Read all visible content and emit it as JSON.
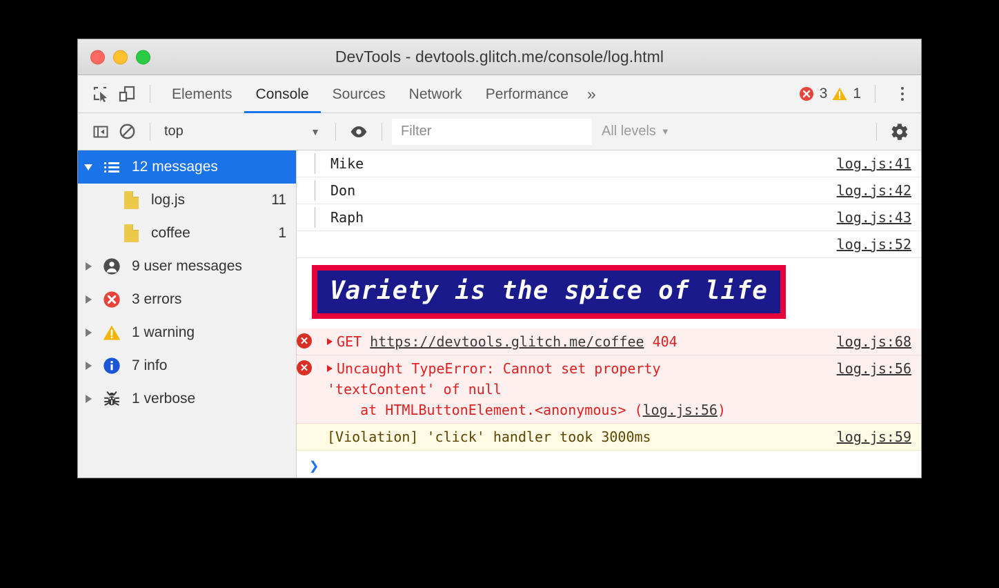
{
  "window": {
    "title": "DevTools - devtools.glitch.me/console/log.html",
    "traffic_lights": [
      "close",
      "minimize",
      "zoom"
    ]
  },
  "tabbar": {
    "inspect_icon": "inspect-element-icon",
    "device_icon": "device-toolbar-icon",
    "tabs": [
      {
        "label": "Elements",
        "active": false
      },
      {
        "label": "Console",
        "active": true
      },
      {
        "label": "Sources",
        "active": false
      },
      {
        "label": "Network",
        "active": false
      },
      {
        "label": "Performance",
        "active": false
      }
    ],
    "more_tabs_label": "»",
    "error_count": "3",
    "warning_count": "1",
    "error_icon": "error-circle-icon",
    "warning_icon": "warning-triangle-icon",
    "menu_icon": "kebab-menu-icon"
  },
  "toolbar": {
    "sidebar_toggle_icon": "sidebar-toggle-icon",
    "clear_console_icon": "clear-console-icon",
    "context": "top",
    "context_caret": "▼",
    "eye_icon": "live-expression-eye-icon",
    "filter_placeholder": "Filter",
    "filter_value": "",
    "levels_label": "All levels",
    "levels_caret": "▼",
    "settings_icon": "settings-gear-icon"
  },
  "sidebar": {
    "items": [
      {
        "label": "12 messages",
        "count": "",
        "icon": "message-list-icon",
        "selected": true,
        "expanded": true,
        "indent": 0
      },
      {
        "label": "log.js",
        "count": "11",
        "icon": "file-icon",
        "selected": false,
        "expanded": null,
        "indent": 1
      },
      {
        "label": "coffee",
        "count": "1",
        "icon": "file-icon",
        "selected": false,
        "expanded": null,
        "indent": 1
      },
      {
        "label": "9 user messages",
        "count": "",
        "icon": "user-icon",
        "selected": false,
        "expanded": false,
        "indent": 0
      },
      {
        "label": "3 errors",
        "count": "",
        "icon": "error-circle-icon",
        "selected": false,
        "expanded": false,
        "indent": 0
      },
      {
        "label": "1 warning",
        "count": "",
        "icon": "warning-triangle-icon",
        "selected": false,
        "expanded": false,
        "indent": 0
      },
      {
        "label": "7 info",
        "count": "",
        "icon": "info-circle-icon",
        "selected": false,
        "expanded": false,
        "indent": 0
      },
      {
        "label": "1 verbose",
        "count": "",
        "icon": "bug-icon",
        "selected": false,
        "expanded": false,
        "indent": 0
      }
    ]
  },
  "console": {
    "messages": [
      {
        "type": "log",
        "text": "Mike",
        "source": "log.js:41",
        "grouped": true
      },
      {
        "type": "log",
        "text": "Don",
        "source": "log.js:42",
        "grouped": true
      },
      {
        "type": "log",
        "text": "Raph",
        "source": "log.js:43",
        "grouped": true
      },
      {
        "type": "styled",
        "text": "Variety is the spice of life",
        "source": "log.js:52",
        "grouped": false,
        "style": {
          "background": "#1a1a8c",
          "border_color": "#e6003c",
          "color": "#ffffff"
        }
      },
      {
        "type": "error-network",
        "method": "GET",
        "url": "https://devtools.glitch.me/coffee",
        "status": "404",
        "source": "log.js:68"
      },
      {
        "type": "error",
        "line1": "Uncaught TypeError: Cannot set property",
        "line2": "'textContent' of null",
        "line3_prefix": "at HTMLButtonElement.<anonymous> (",
        "line3_link": "log.js:56",
        "line3_suffix": ")",
        "source": "log.js:56"
      },
      {
        "type": "violation",
        "text": "[Violation] 'click' handler took 3000ms",
        "source": "log.js:59"
      }
    ],
    "prompt_symbol": "❯",
    "prompt_value": ""
  },
  "colors": {
    "accent_blue": "#1a73e8",
    "error_red": "#d93025",
    "error_text": "#e02020",
    "warning_yellow": "#f5b400",
    "info_blue": "#1a56d6",
    "styled_bg": "#1a1a8c",
    "styled_border": "#e6003c",
    "error_row_bg": "#fff0f0",
    "violation_row_bg": "#fffbe5"
  }
}
